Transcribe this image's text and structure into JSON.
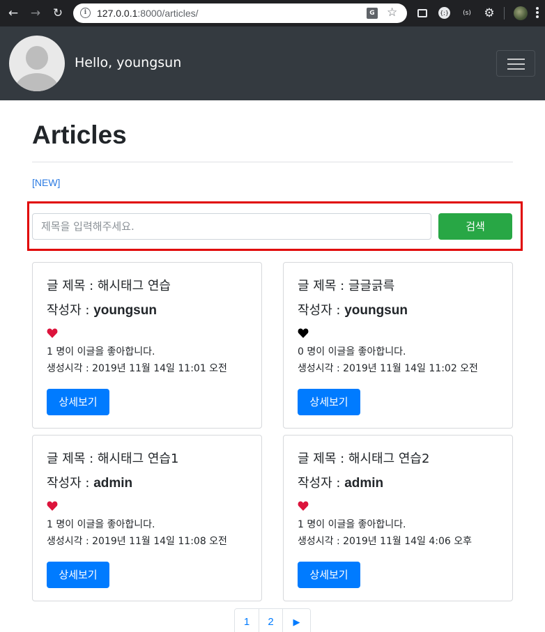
{
  "browser": {
    "url_host": "127.0.0.1",
    "url_rest": ":8000/articles/"
  },
  "navbar": {
    "greeting": "Hello, youngsun"
  },
  "page": {
    "title": "Articles",
    "new_link": "[NEW]"
  },
  "search": {
    "placeholder": "제목을 입력해주세요.",
    "button_label": "검색"
  },
  "articles": [
    {
      "title": "글 제목 : 해시태그 연습",
      "author_label": "작성자 : ",
      "author": "youngsun",
      "liked": true,
      "likes_text": "1 명이 이글을 좋아합니다.",
      "created_text": "생성시각 : 2019년 11월 14일 11:01 오전",
      "button_label": "상세보기"
    },
    {
      "title": "글 제목 : 글글긁륵",
      "author_label": "작성자 : ",
      "author": "youngsun",
      "liked": false,
      "likes_text": "0 명이 이글을 좋아합니다.",
      "created_text": "생성시각 : 2019년 11월 14일 11:02 오전",
      "button_label": "상세보기"
    },
    {
      "title": "글 제목 : 해시태그 연습1",
      "author_label": "작성자 : ",
      "author": "admin",
      "liked": true,
      "likes_text": "1 명이 이글을 좋아합니다.",
      "created_text": "생성시각 : 2019년 11월 14일 11:08 오전",
      "button_label": "상세보기"
    },
    {
      "title": "글 제목 : 해시태그 연습2",
      "author_label": "작성자 : ",
      "author": "admin",
      "liked": true,
      "likes_text": "1 명이 이글을 좋아합니다.",
      "created_text": "생성시각 : 2019년 11월 14일 4:06 오후",
      "button_label": "상세보기"
    }
  ],
  "pagination": {
    "pages": [
      "1",
      "2"
    ],
    "next_symbol": "▶"
  },
  "colors": {
    "navbar": "#343a40",
    "primary": "#007bff",
    "success": "#28a745",
    "heart_liked": "#dc143c",
    "heart_unliked": "#000000",
    "highlight": "#e00000"
  }
}
